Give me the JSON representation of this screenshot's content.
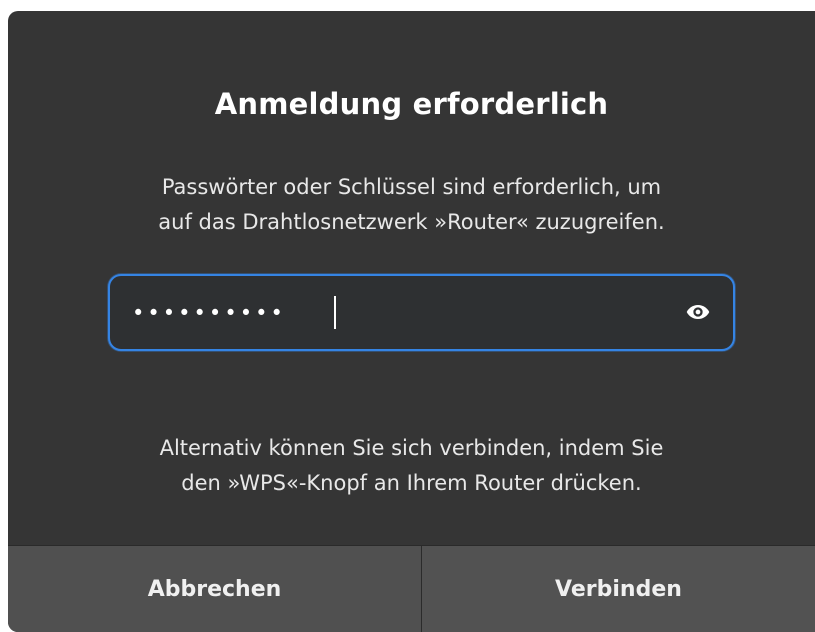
{
  "dialog": {
    "title": "Anmeldung erforderlich",
    "message_line1": "Passwörter oder Schlüssel sind erforderlich, um",
    "message_line2": "auf das Drahtlosnetzwerk »Router« zuzugreifen.",
    "password": {
      "masked_value": "••••••••••",
      "reveal_icon": "eye-icon"
    },
    "alternative_line1": "Alternativ können Sie sich verbinden, indem Sie",
    "alternative_line2": "den »WPS«-Knopf an Ihrem Router drücken."
  },
  "buttons": {
    "cancel_label": "Abbrechen",
    "connect_label": "Verbinden"
  },
  "colors": {
    "dialog_background": "#353535",
    "field_background": "#2e3032",
    "focus_border": "#3584e4",
    "button_background": "#505050",
    "text": "#ffffff"
  }
}
